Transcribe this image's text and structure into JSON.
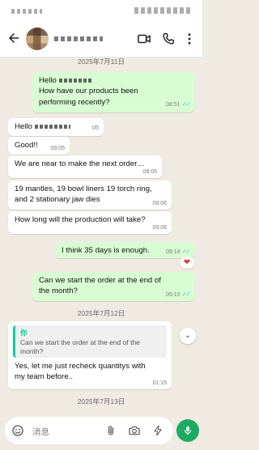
{
  "header": {
    "contact_name_visible": "",
    "back_icon": "arrow-left-icon",
    "video_icon": "video-call-icon",
    "call_icon": "phone-icon",
    "menu_icon": "more-vertical-icon"
  },
  "chat": {
    "dates": [
      "2025年7月11日",
      "2025年7月12日",
      "2025年7月13日"
    ],
    "messages": [
      {
        "dir": "out",
        "lines": [
          "Hello",
          "How have our products been",
          "performing recently?"
        ],
        "time": "08:51",
        "read": true
      },
      {
        "dir": "in",
        "lines": [
          "Hello"
        ],
        "time": ":05"
      },
      {
        "dir": "in",
        "lines": [
          "Good!!"
        ],
        "time": "09:05"
      },
      {
        "dir": "in",
        "lines": [
          "We are near to make the next order…"
        ],
        "time": "09:05"
      },
      {
        "dir": "in",
        "lines": [
          "19 mantles, 19 bowl liners 19 torch ring,",
          "and 2  stationary jaw dies"
        ],
        "time": "09:06"
      },
      {
        "dir": "in",
        "lines": [
          "How long will the production will take?"
        ],
        "time": "09:06"
      },
      {
        "dir": "out",
        "lines": [
          "I think 35 days is enough."
        ],
        "time": "09:14",
        "read": true,
        "reaction": "❤"
      },
      {
        "dir": "out",
        "lines": [
          "Can we start the order at the end of",
          "the month?"
        ],
        "time": "09:15",
        "read": true
      },
      {
        "dir": "in",
        "quote_author": "你",
        "quote_lines": [
          "Can we start the order at the end of the",
          "month?"
        ],
        "lines": [
          "Yes, let me just recheck quantitys with",
          "my team before.."
        ],
        "time": "01:19"
      }
    ]
  },
  "input": {
    "placeholder": "消息",
    "emoji_icon": "emoji-icon",
    "attach_icon": "paperclip-icon",
    "camera_icon": "camera-icon",
    "bolt_icon": "lightning-icon",
    "mic_icon": "microphone-icon"
  },
  "scroll_icon": "chevron-double-down-icon",
  "colors": {
    "outgoing": "#d9fdd3",
    "incoming": "#ffffff",
    "accent": "#1daa61",
    "read_ticks": "#53bdeb"
  }
}
